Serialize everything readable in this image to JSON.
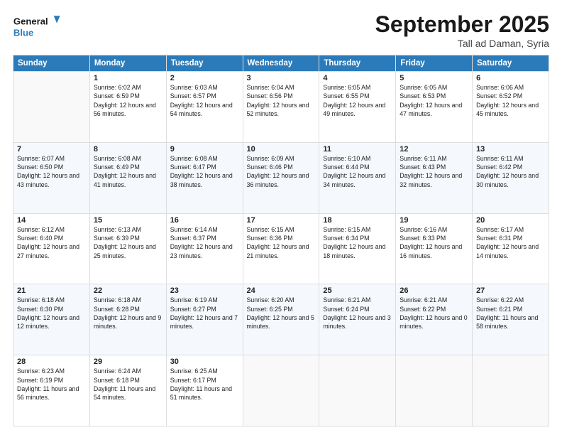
{
  "header": {
    "logo_line1": "General",
    "logo_line2": "Blue",
    "month": "September 2025",
    "location": "Tall ad Daman, Syria"
  },
  "weekdays": [
    "Sunday",
    "Monday",
    "Tuesday",
    "Wednesday",
    "Thursday",
    "Friday",
    "Saturday"
  ],
  "weeks": [
    [
      {
        "day": "",
        "empty": true
      },
      {
        "day": "1",
        "sunrise": "6:02 AM",
        "sunset": "6:59 PM",
        "daylight": "12 hours and 56 minutes."
      },
      {
        "day": "2",
        "sunrise": "6:03 AM",
        "sunset": "6:57 PM",
        "daylight": "12 hours and 54 minutes."
      },
      {
        "day": "3",
        "sunrise": "6:04 AM",
        "sunset": "6:56 PM",
        "daylight": "12 hours and 52 minutes."
      },
      {
        "day": "4",
        "sunrise": "6:05 AM",
        "sunset": "6:55 PM",
        "daylight": "12 hours and 49 minutes."
      },
      {
        "day": "5",
        "sunrise": "6:05 AM",
        "sunset": "6:53 PM",
        "daylight": "12 hours and 47 minutes."
      },
      {
        "day": "6",
        "sunrise": "6:06 AM",
        "sunset": "6:52 PM",
        "daylight": "12 hours and 45 minutes."
      }
    ],
    [
      {
        "day": "7",
        "sunrise": "6:07 AM",
        "sunset": "6:50 PM",
        "daylight": "12 hours and 43 minutes."
      },
      {
        "day": "8",
        "sunrise": "6:08 AM",
        "sunset": "6:49 PM",
        "daylight": "12 hours and 41 minutes."
      },
      {
        "day": "9",
        "sunrise": "6:08 AM",
        "sunset": "6:47 PM",
        "daylight": "12 hours and 38 minutes."
      },
      {
        "day": "10",
        "sunrise": "6:09 AM",
        "sunset": "6:46 PM",
        "daylight": "12 hours and 36 minutes."
      },
      {
        "day": "11",
        "sunrise": "6:10 AM",
        "sunset": "6:44 PM",
        "daylight": "12 hours and 34 minutes."
      },
      {
        "day": "12",
        "sunrise": "6:11 AM",
        "sunset": "6:43 PM",
        "daylight": "12 hours and 32 minutes."
      },
      {
        "day": "13",
        "sunrise": "6:11 AM",
        "sunset": "6:42 PM",
        "daylight": "12 hours and 30 minutes."
      }
    ],
    [
      {
        "day": "14",
        "sunrise": "6:12 AM",
        "sunset": "6:40 PM",
        "daylight": "12 hours and 27 minutes."
      },
      {
        "day": "15",
        "sunrise": "6:13 AM",
        "sunset": "6:39 PM",
        "daylight": "12 hours and 25 minutes."
      },
      {
        "day": "16",
        "sunrise": "6:14 AM",
        "sunset": "6:37 PM",
        "daylight": "12 hours and 23 minutes."
      },
      {
        "day": "17",
        "sunrise": "6:15 AM",
        "sunset": "6:36 PM",
        "daylight": "12 hours and 21 minutes."
      },
      {
        "day": "18",
        "sunrise": "6:15 AM",
        "sunset": "6:34 PM",
        "daylight": "12 hours and 18 minutes."
      },
      {
        "day": "19",
        "sunrise": "6:16 AM",
        "sunset": "6:33 PM",
        "daylight": "12 hours and 16 minutes."
      },
      {
        "day": "20",
        "sunrise": "6:17 AM",
        "sunset": "6:31 PM",
        "daylight": "12 hours and 14 minutes."
      }
    ],
    [
      {
        "day": "21",
        "sunrise": "6:18 AM",
        "sunset": "6:30 PM",
        "daylight": "12 hours and 12 minutes."
      },
      {
        "day": "22",
        "sunrise": "6:18 AM",
        "sunset": "6:28 PM",
        "daylight": "12 hours and 9 minutes."
      },
      {
        "day": "23",
        "sunrise": "6:19 AM",
        "sunset": "6:27 PM",
        "daylight": "12 hours and 7 minutes."
      },
      {
        "day": "24",
        "sunrise": "6:20 AM",
        "sunset": "6:25 PM",
        "daylight": "12 hours and 5 minutes."
      },
      {
        "day": "25",
        "sunrise": "6:21 AM",
        "sunset": "6:24 PM",
        "daylight": "12 hours and 3 minutes."
      },
      {
        "day": "26",
        "sunrise": "6:21 AM",
        "sunset": "6:22 PM",
        "daylight": "12 hours and 0 minutes."
      },
      {
        "day": "27",
        "sunrise": "6:22 AM",
        "sunset": "6:21 PM",
        "daylight": "11 hours and 58 minutes."
      }
    ],
    [
      {
        "day": "28",
        "sunrise": "6:23 AM",
        "sunset": "6:19 PM",
        "daylight": "11 hours and 56 minutes."
      },
      {
        "day": "29",
        "sunrise": "6:24 AM",
        "sunset": "6:18 PM",
        "daylight": "11 hours and 54 minutes."
      },
      {
        "day": "30",
        "sunrise": "6:25 AM",
        "sunset": "6:17 PM",
        "daylight": "11 hours and 51 minutes."
      },
      {
        "day": "",
        "empty": true
      },
      {
        "day": "",
        "empty": true
      },
      {
        "day": "",
        "empty": true
      },
      {
        "day": "",
        "empty": true
      }
    ]
  ]
}
